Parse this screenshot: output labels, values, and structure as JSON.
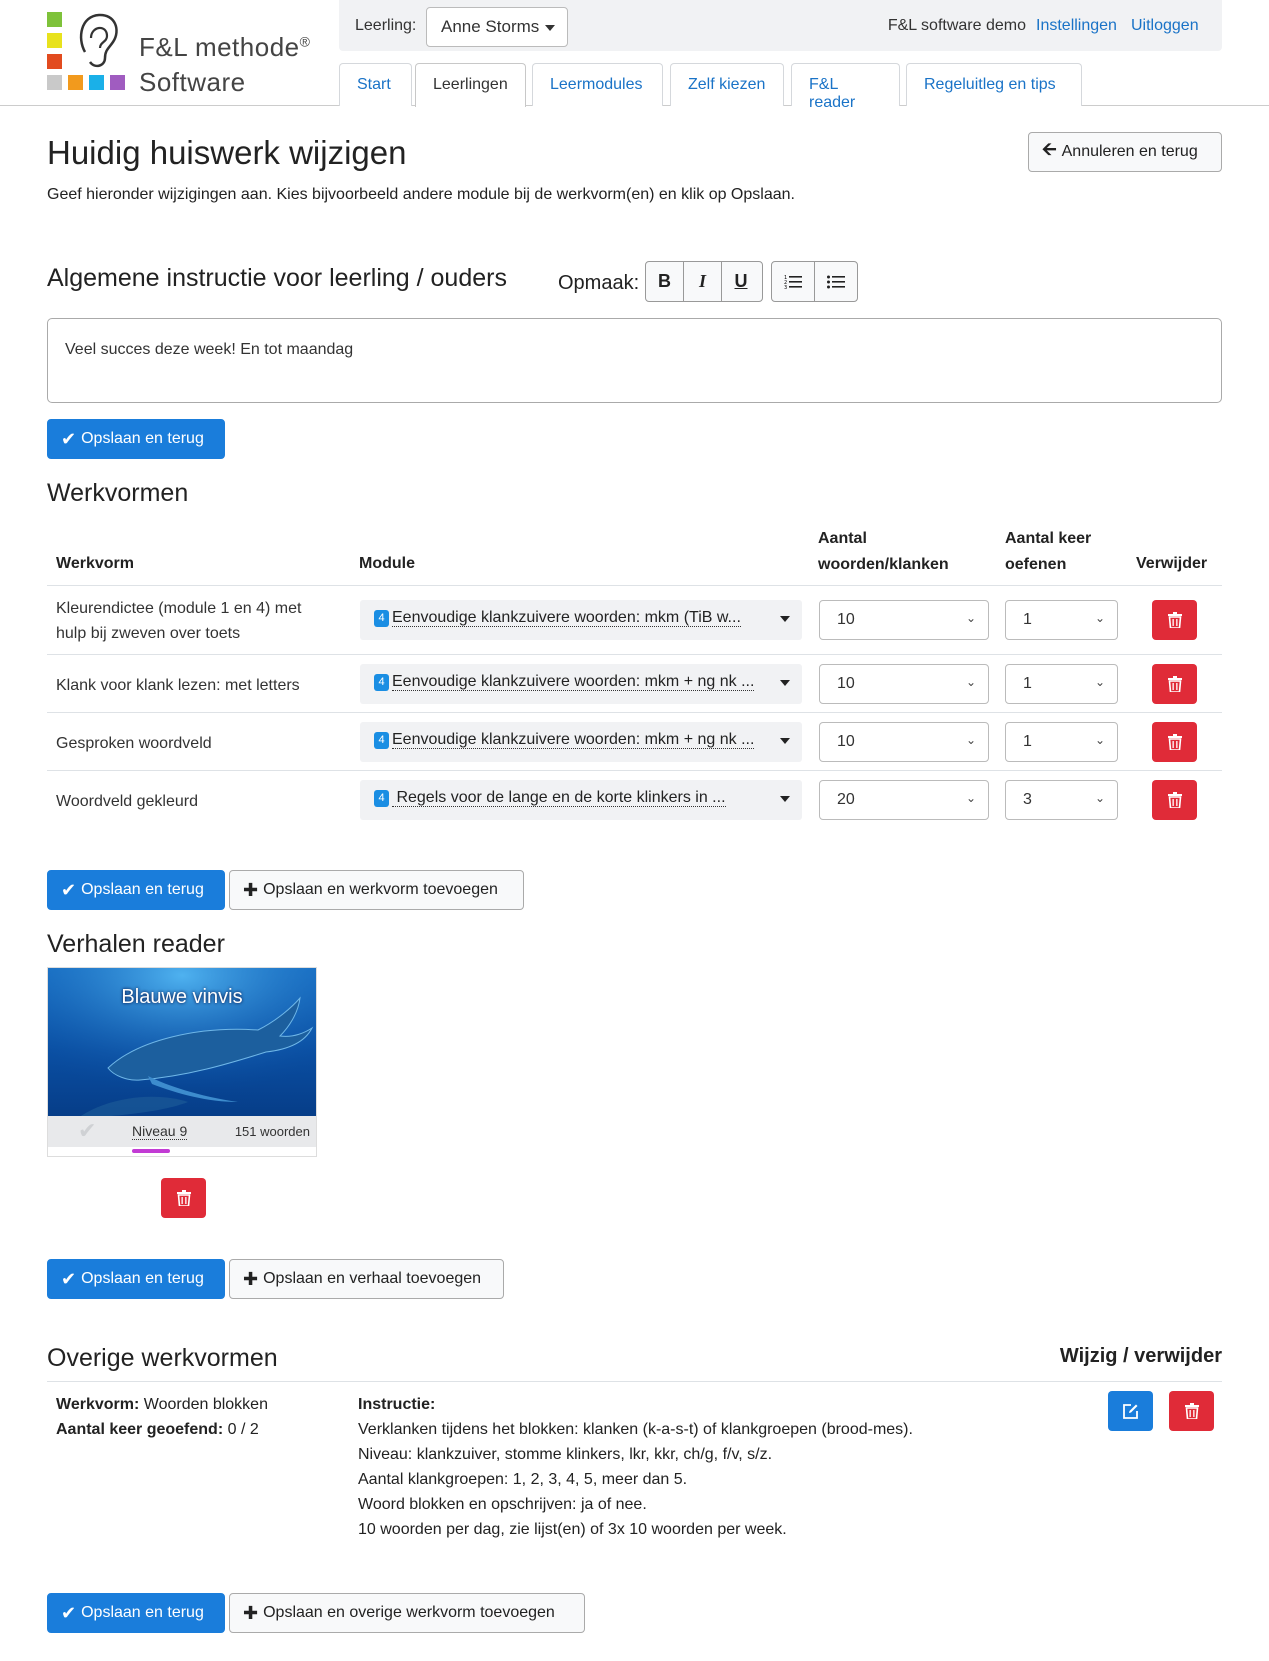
{
  "header": {
    "brand_line1": "F&L methode",
    "brand_reg": "®",
    "brand_line2": "Software",
    "student_label": "Leerling:",
    "student_value": "Anne Storms",
    "demo_name": "F&L software demo",
    "settings_link": "Instellingen",
    "logout_link": "Uitloggen",
    "tabs": [
      {
        "label": "Start"
      },
      {
        "label": "Leerlingen"
      },
      {
        "label": "Leermodules"
      },
      {
        "label": "Zelf kiezen"
      },
      {
        "label": "F&L reader"
      },
      {
        "label": "Regeluitleg en tips"
      }
    ],
    "colors": {
      "yellow": "#e8e21d",
      "green": "#7ec23a",
      "red": "#e24b1f",
      "orange": "#f29a1d",
      "cyan": "#1ab0e8",
      "purple": "#a05cc0",
      "grey": "#c9c9c9"
    }
  },
  "page": {
    "title": "Huidig huiswerk wijzigen",
    "subtitle": "Geef hieronder wijzigingen aan. Kies bijvoorbeeld andere module bij de werkvorm(en) en klik op Opslaan.",
    "cancel_button": "Annuleren en terug"
  },
  "instruction": {
    "heading": "Algemene instructie voor leerling / ouders",
    "format_label": "Opmaak:",
    "format_buttons": {
      "bold": "B",
      "italic": "I",
      "underline": "U"
    },
    "text": "Veel succes deze week! En tot maandag",
    "save_button": "Opslaan en terug"
  },
  "werkvormen": {
    "heading": "Werkvormen",
    "columns": {
      "werkvorm": "Werkvorm",
      "module": "Module",
      "aantal_line1": "Aantal",
      "aantal_line2": "woorden/klanken",
      "keer_line1": "Aantal keer",
      "keer_line2": "oefenen",
      "verwijder": "Verwijder"
    },
    "rows": [
      {
        "name_line1": "Kleurendictee (module 1 en 4) met",
        "name_line2": "hulp bij zweven over toets",
        "badge": "4",
        "module": "Eenvoudige klankzuivere woorden: mkm (TiB w...",
        "count": "10",
        "times": "1"
      },
      {
        "name_line1": "Klank voor klank lezen: met letters",
        "name_line2": "",
        "badge": "4",
        "module": "Eenvoudige klankzuivere woorden: mkm + ng nk ...",
        "count": "10",
        "times": "1"
      },
      {
        "name_line1": "Gesproken woordveld",
        "name_line2": "",
        "badge": "4",
        "module": "Eenvoudige klankzuivere woorden: mkm + ng nk ...",
        "count": "10",
        "times": "1"
      },
      {
        "name_line1": "Woordveld gekleurd",
        "name_line2": "",
        "badge": "4",
        "module": " Regels voor de lange en de korte klinkers in ...",
        "count": "20",
        "times": "3"
      }
    ],
    "save_button": "Opslaan en terug",
    "add_button": "Opslaan en werkvorm toevoegen"
  },
  "reader": {
    "heading": "Verhalen reader",
    "story": {
      "title": "Blauwe vinvis",
      "level": "Niveau 9",
      "words": "151 woorden",
      "progress": 0.14
    },
    "save_button": "Opslaan en terug",
    "add_button": "Opslaan en verhaal toevoegen"
  },
  "overige": {
    "heading": "Overige werkvormen",
    "actions_heading": "Wijzig / verwijder",
    "werkvorm_label": "Werkvorm:",
    "werkvorm_value": "Woorden blokken",
    "geoefend_label": "Aantal keer geoefend:",
    "geoefend_value": "0 / 2",
    "instructie_label": "Instructie:",
    "instructie_lines": [
      "Verklanken tijdens het blokken: klanken (k-a-s-t) of klankgroepen (brood-mes).",
      "Niveau: klankzuiver, stomme klinkers, lkr, kkr, ch/g, f/v, s/z.",
      "Aantal klankgroepen: 1, 2, 3, 4, 5, meer dan 5.",
      "Woord blokken en opschrijven: ja of nee.",
      "10 woorden per dag, zie lijst(en) of 3x 10 woorden per week."
    ],
    "save_button": "Opslaan en terug",
    "add_button": "Opslaan en overige werkvorm toevoegen"
  }
}
